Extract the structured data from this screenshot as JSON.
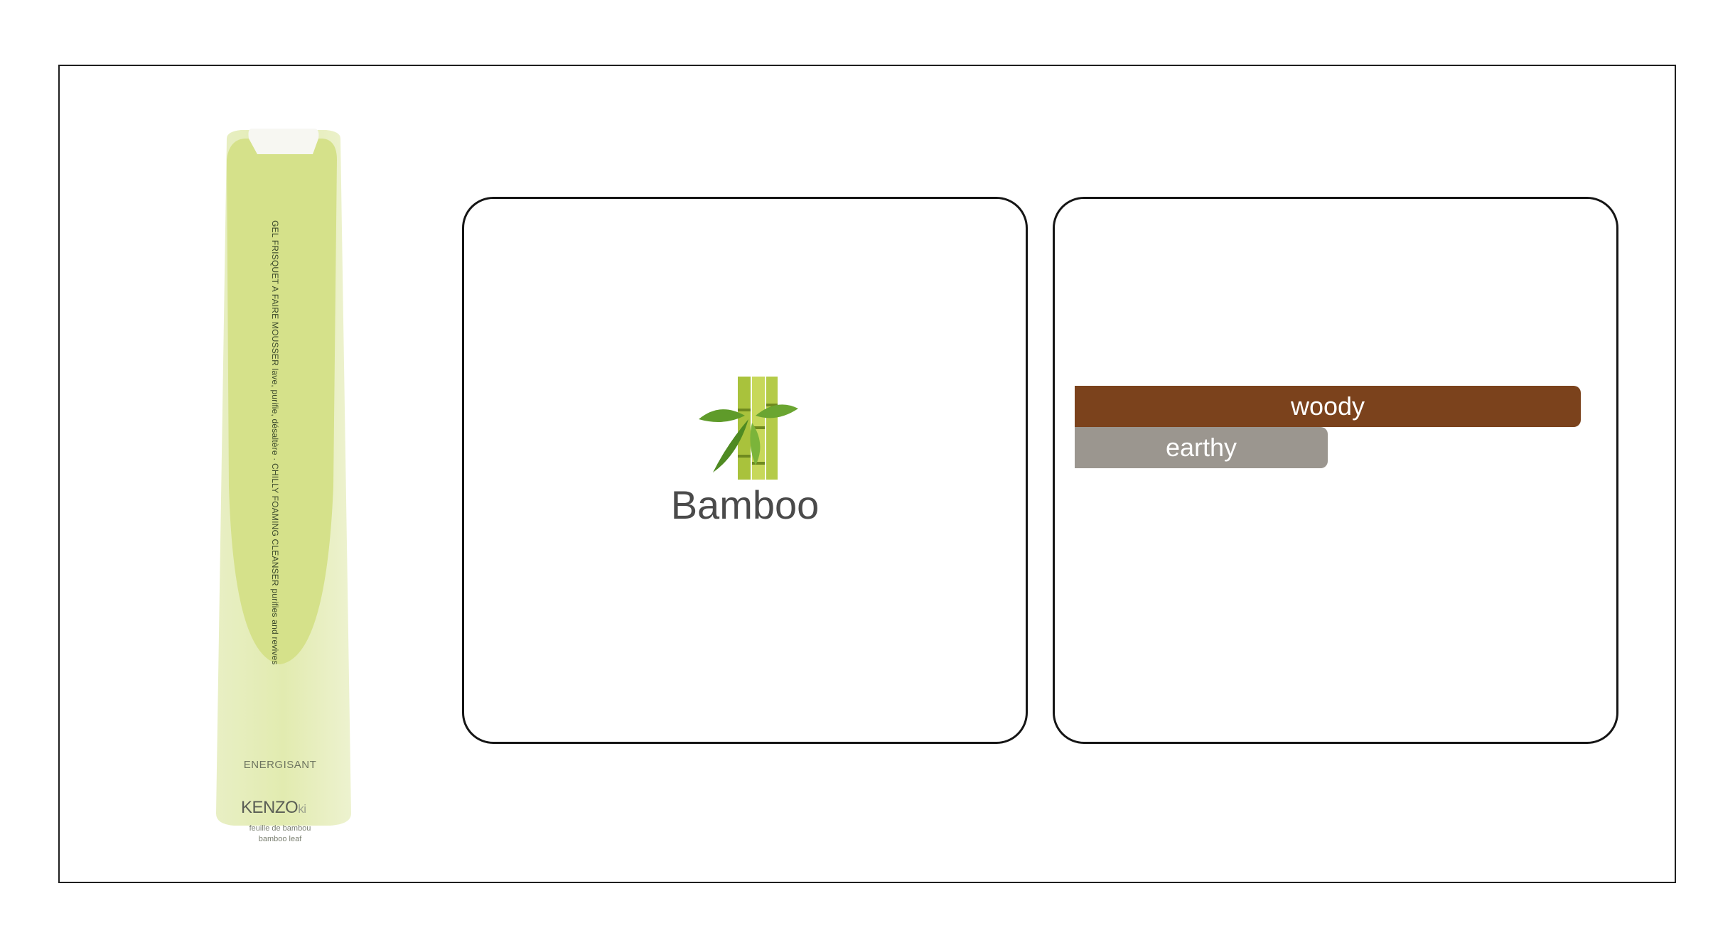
{
  "product": {
    "vertical_text": "GEL FRISQUET A FAIRE MOUSSER lave, purifie, désaltère · CHILLY FOAMING CLEANSER purifies and revives",
    "variant": "ENERGISANT",
    "brand": "KENZO",
    "brand_suffix": "ki",
    "subtitle_line1": "feuille de bambou",
    "subtitle_line2": "bamboo leaf",
    "colors": {
      "bottle": "#dfe9a8",
      "oval": "#d3e084",
      "cap": "#f6f6f0"
    }
  },
  "ingredient": {
    "icon": "bamboo-icon",
    "label": "Bamboo"
  },
  "notes": [
    {
      "label": "woody",
      "strength": 1.0,
      "color": "#7b421c"
    },
    {
      "label": "earthy",
      "strength": 0.5,
      "color": "#9b968f"
    }
  ]
}
